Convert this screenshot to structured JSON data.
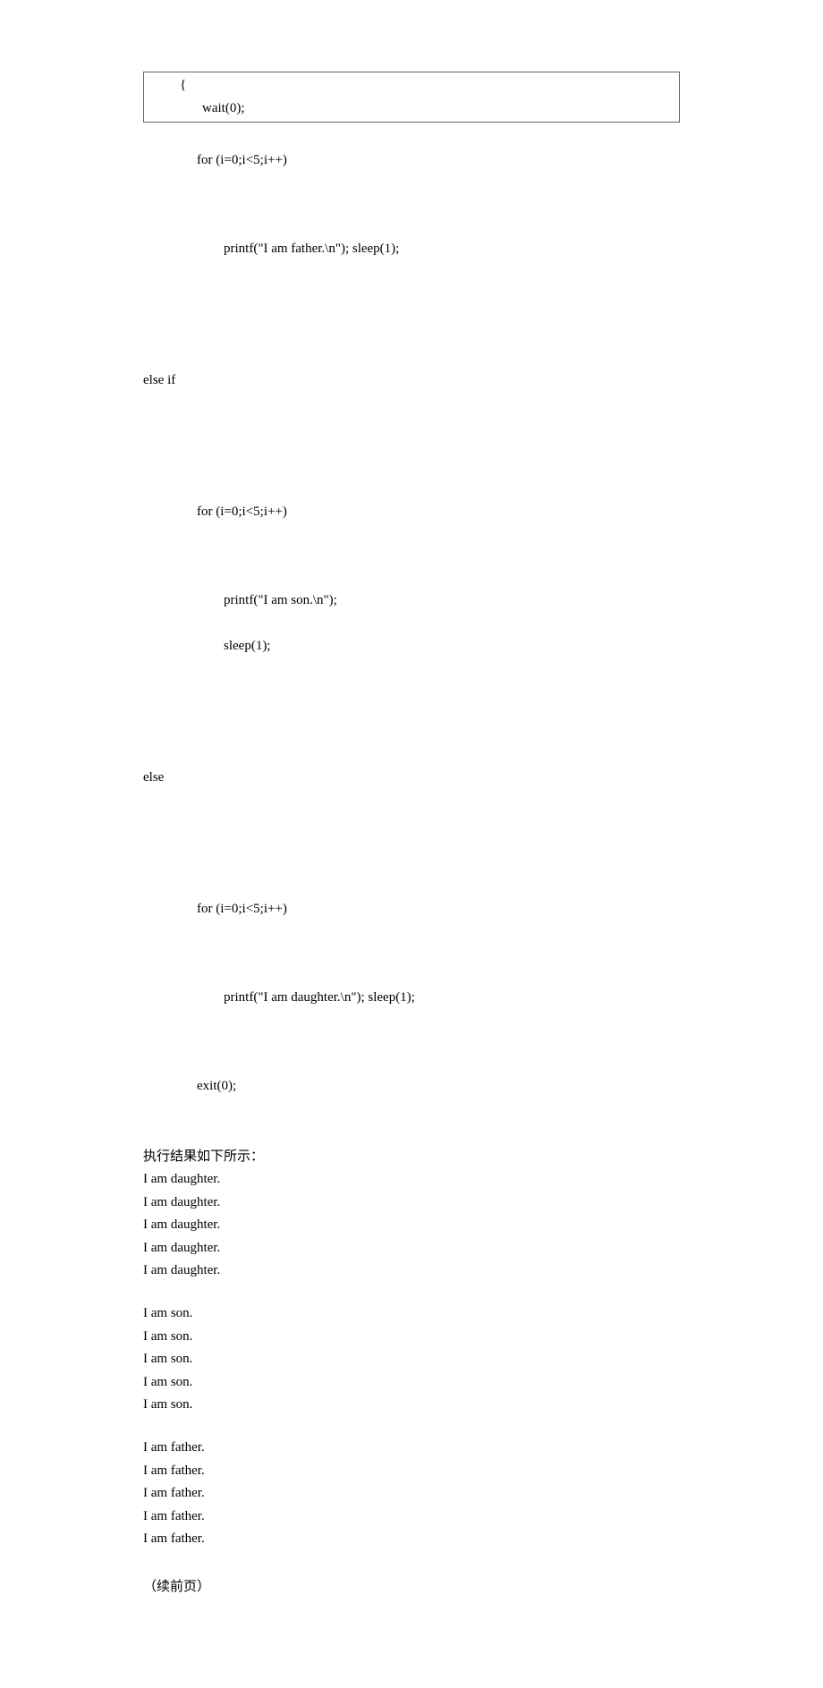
{
  "code_box": {
    "line1": "{",
    "line2": "wait(0);"
  },
  "code": {
    "l1": "                for (i=0;i<5;i++)",
    "l2": "                        printf(\"I am father.\\n\"); sleep(1);",
    "l3": "else if",
    "l4": "                for (i=0;i<5;i++)",
    "l5": "                        printf(\"I am son.\\n\");",
    "l6": "                        sleep(1);",
    "l7": "else",
    "l8": "                for (i=0;i<5;i++)",
    "l9": "                        printf(\"I am daughter.\\n\"); sleep(1);",
    "l10": "                exit(0);"
  },
  "heading": "执行结果如下所示：",
  "output": {
    "d1": "I am daughter.",
    "d2": "I am daughter.",
    "d3": "I am daughter.",
    "d4": "I am daughter.",
    "d5": "I am daughter.",
    "s1": "I am son.",
    "s2": "I am son.",
    "s3": "I am son.",
    "s4": "I am son.",
    "s5": "I am son.",
    "f1": "I am father.",
    "f2": "I am father.",
    "f3": "I am father.",
    "f4": "I am father.",
    "f5": "I am father."
  },
  "footnote": "（续前页）"
}
